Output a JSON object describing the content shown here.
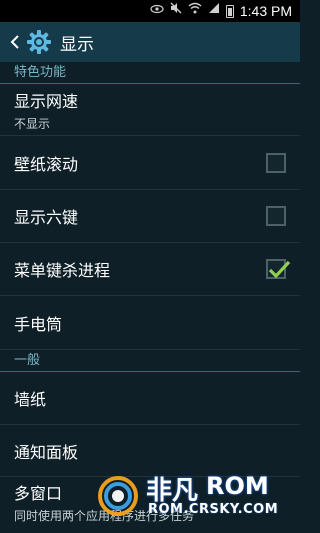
{
  "status_bar": {
    "time": "1:43 PM",
    "icons": [
      "eye-icon",
      "mute-icon",
      "wifi-icon",
      "signal-icon",
      "battery-icon"
    ]
  },
  "action_bar": {
    "title": "显示",
    "back_icon": "chevron-left-icon",
    "settings_icon": "gear-icon"
  },
  "sections": {
    "special": {
      "header": "特色功能"
    },
    "general": {
      "header": "一般"
    }
  },
  "items": {
    "network_speed": {
      "label": "显示网速",
      "summary": "不显示"
    },
    "wallpaper_scroll": {
      "label": "壁纸滚动",
      "checked": false
    },
    "six_keys": {
      "label": "显示六键",
      "checked": false
    },
    "menu_kill": {
      "label": "菜单键杀进程",
      "checked": true
    },
    "flashlight": {
      "label": "手电筒"
    },
    "wallpaper": {
      "label": "墙纸"
    },
    "notification_panel": {
      "label": "通知面板"
    },
    "multi_window": {
      "label": "多窗口",
      "summary": "同时使用两个应用程序进行多任务"
    }
  },
  "watermark": {
    "brand": "非凡",
    "rom": "ROM",
    "url": "ROM.CRSKY.COM"
  },
  "colors": {
    "background": "#0e1f27",
    "action_bar": "#153b4a",
    "accent": "#7bb6c8",
    "check_green": "#8fd14f"
  }
}
